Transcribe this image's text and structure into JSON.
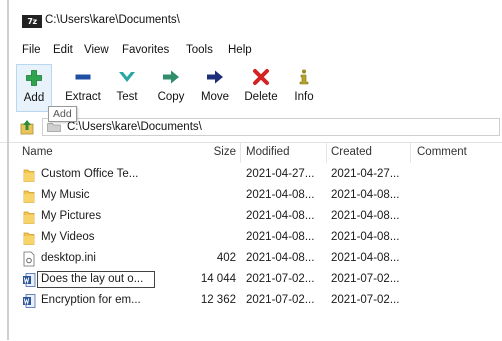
{
  "window": {
    "app_icon_text": "7z",
    "title": "C:\\Users\\kare\\Documents\\"
  },
  "menu": [
    "File",
    "Edit",
    "View",
    "Favorites",
    "Tools",
    "Help"
  ],
  "toolbar": {
    "buttons": [
      {
        "label": "Add",
        "icon": "plus-icon",
        "color": "#2ea44f"
      },
      {
        "label": "Extract",
        "icon": "minus-icon",
        "color": "#1f4fa3"
      },
      {
        "label": "Test",
        "icon": "check-icon",
        "color": "#2aa7a0"
      },
      {
        "label": "Copy",
        "icon": "arrow-right-icon",
        "color": "#2f8f6a"
      },
      {
        "label": "Move",
        "icon": "arrow-right-icon",
        "color": "#1e2f7a"
      },
      {
        "label": "Delete",
        "icon": "x-icon",
        "color": "#d32222"
      },
      {
        "label": "Info",
        "icon": "info-icon",
        "color": "#9a8a1a"
      }
    ],
    "tooltip": "Add"
  },
  "address": {
    "path": "C:\\Users\\kare\\Documents\\"
  },
  "file_list": {
    "columns": [
      "Name",
      "Size",
      "Modified",
      "Created",
      "Comment"
    ],
    "rows": [
      {
        "name": "Custom Office Te...",
        "size": "",
        "modified": "2021-04-27...",
        "created": "2021-04-27...",
        "comment": "",
        "type": "folder"
      },
      {
        "name": "My Music",
        "size": "",
        "modified": "2021-04-08...",
        "created": "2021-04-08...",
        "comment": "",
        "type": "folder"
      },
      {
        "name": "My Pictures",
        "size": "",
        "modified": "2021-04-08...",
        "created": "2021-04-08...",
        "comment": "",
        "type": "folder"
      },
      {
        "name": "My Videos",
        "size": "",
        "modified": "2021-04-08...",
        "created": "2021-04-08...",
        "comment": "",
        "type": "folder"
      },
      {
        "name": "desktop.ini",
        "size": "402",
        "modified": "2021-04-08...",
        "created": "2021-04-08...",
        "comment": "",
        "type": "ini"
      },
      {
        "name": "Does the lay out o...",
        "size": "14 044",
        "modified": "2021-07-02...",
        "created": "2021-07-02...",
        "comment": "",
        "type": "word"
      },
      {
        "name": "Encryption for em...",
        "size": "12 362",
        "modified": "2021-07-02...",
        "created": "2021-07-02...",
        "comment": "",
        "type": "word"
      }
    ]
  }
}
